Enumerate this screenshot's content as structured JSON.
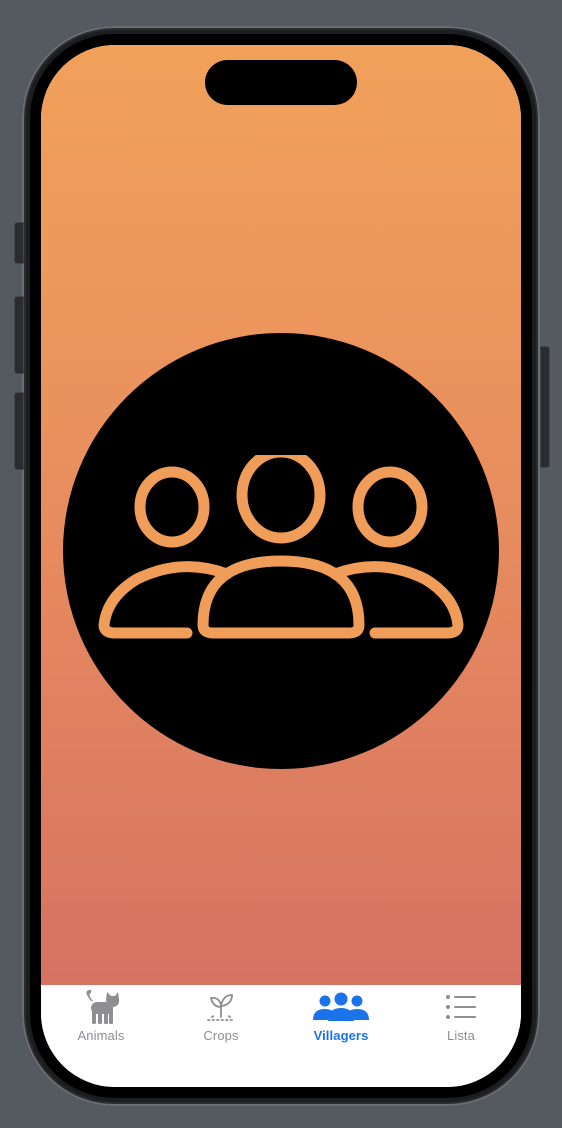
{
  "tabbar": {
    "tabs": [
      {
        "label": "Animals",
        "icon": "cat-icon",
        "active": false
      },
      {
        "label": "Crops",
        "icon": "sprout-icon",
        "active": false
      },
      {
        "label": "Villagers",
        "icon": "people-icon",
        "active": true
      },
      {
        "label": "Lista",
        "icon": "list-icon",
        "active": false
      }
    ]
  },
  "hero": {
    "icon": "villagers-icon"
  },
  "colors": {
    "gradient_top": "#f1a15a",
    "gradient_bottom": "#d67262",
    "hero_icon_stroke": "#ef9d59",
    "tab_active": "#1a73e8",
    "tab_inactive": "#8e8e93"
  }
}
